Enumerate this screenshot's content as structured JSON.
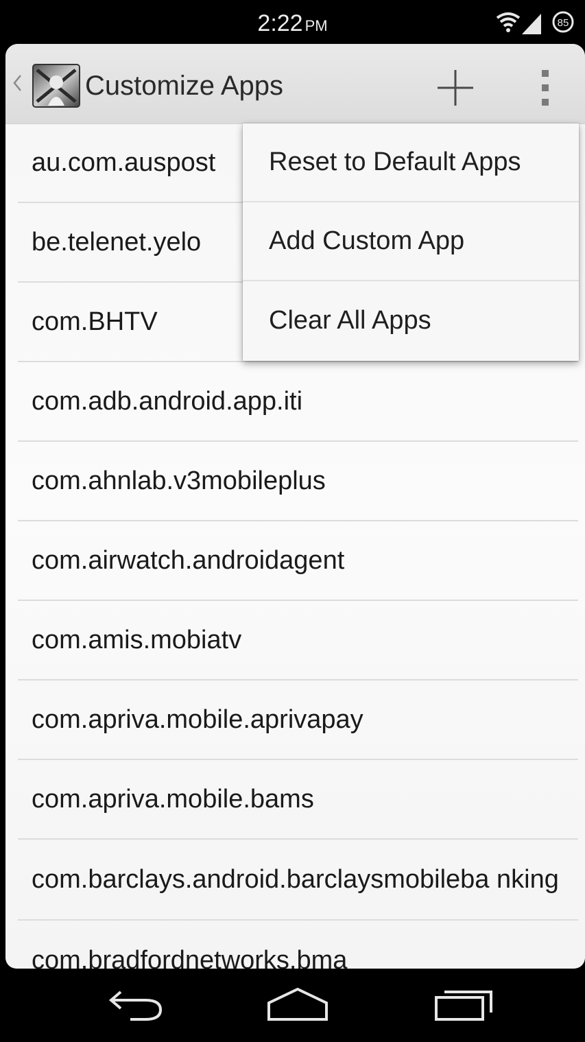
{
  "status_bar": {
    "time": "2:22",
    "ampm": "PM",
    "battery": "85",
    "icons": [
      "wifi-icon",
      "signal-icon",
      "battery-icon"
    ]
  },
  "action_bar": {
    "title": "Customize Apps",
    "icons": [
      "up-caret-icon",
      "app-icon",
      "add-icon",
      "overflow-menu-icon"
    ]
  },
  "app_list": [
    "au.com.auspost",
    "be.telenet.yelo",
    "com.BHTV",
    "com.adb.android.app.iti",
    "com.ahnlab.v3mobileplus",
    "com.airwatch.androidagent",
    "com.amis.mobiatv",
    "com.apriva.mobile.aprivapay",
    "com.apriva.mobile.bams",
    "com.barclays.android.barclaysmobileba nking",
    "com.bradfordnetworks.bma"
  ],
  "overflow_menu": {
    "items": [
      "Reset to Default Apps",
      "Add Custom App",
      "Clear All Apps"
    ]
  },
  "nav_bar": {
    "icons": [
      "back-icon",
      "home-icon",
      "recents-icon"
    ]
  }
}
